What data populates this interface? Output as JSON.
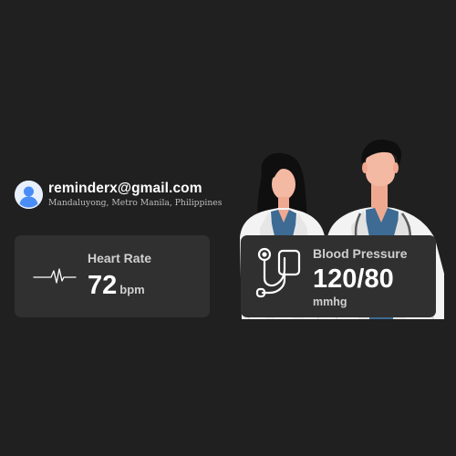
{
  "profile": {
    "email": "reminderx@gmail.com",
    "location": "Mandaluyong, Metro Manila, Philippines",
    "avatar_icon": "user-avatar-icon"
  },
  "heart_rate": {
    "title": "Heart Rate",
    "value": "72",
    "unit": "bpm",
    "icon": "heartbeat-pulse-icon"
  },
  "blood_pressure": {
    "title": "Blood Pressure",
    "value": "120/80",
    "unit": "mmhg",
    "icon": "stethoscope-icon"
  },
  "colors": {
    "background": "#202020",
    "card": "#303030",
    "text_primary": "#ffffff",
    "text_secondary": "#cfcfcf",
    "avatar_blue": "#4a8df6",
    "scrub_blue": "#3d6b93"
  }
}
